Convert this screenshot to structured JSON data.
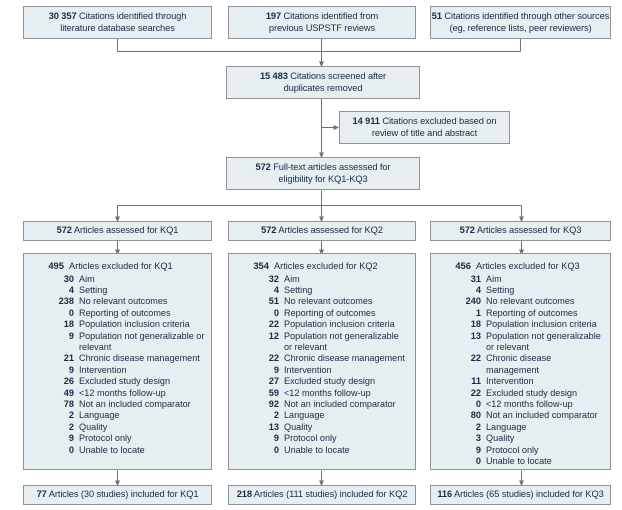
{
  "colors": {
    "box_fill": "#e6eef2",
    "box_border": "#8f9296",
    "text": "#1b2a46",
    "connector": "#6e7278"
  },
  "top_row": [
    {
      "number": "30 357",
      "line1": "Citations identified through",
      "line2": "literature database searches"
    },
    {
      "number": "197",
      "line1": "Citations identified from",
      "line2": "previous USPSTF reviews"
    },
    {
      "number": "51",
      "line1": "Citations identified through other sources",
      "line2": "(eg, reference lists, peer reviewers)"
    }
  ],
  "screened": {
    "number": "15 483",
    "line1": "Citations screened after",
    "line2": "duplicates removed"
  },
  "excluded_title_abstract": {
    "number": "14 911",
    "line1": "Citations excluded based on",
    "line2": "review of title and abstract"
  },
  "fulltext": {
    "number": "572",
    "line1": "Full-text articles assessed for",
    "line2": "eligibility for KQ1-KQ3"
  },
  "assessed": [
    {
      "number": "572",
      "label": "Articles assessed for KQ1"
    },
    {
      "number": "572",
      "label": "Articles assessed for KQ2"
    },
    {
      "number": "572",
      "label": "Articles assessed for KQ3"
    }
  ],
  "exclusions": [
    {
      "head_number": "495",
      "head_label": "Articles excluded for KQ1",
      "reasons": [
        {
          "n": "30",
          "label": "Aim"
        },
        {
          "n": "4",
          "label": "Setting"
        },
        {
          "n": "238",
          "label": "No relevant outcomes"
        },
        {
          "n": "0",
          "label": "Reporting of outcomes"
        },
        {
          "n": "18",
          "label": "Population inclusion criteria"
        },
        {
          "n": "9",
          "label": "Population not generalizable or relevant"
        },
        {
          "n": "21",
          "label": "Chronic disease management"
        },
        {
          "n": "9",
          "label": "Intervention"
        },
        {
          "n": "26",
          "label": "Excluded study design"
        },
        {
          "n": "49",
          "label": "<12 months follow-up"
        },
        {
          "n": "78",
          "label": "Not an included comparator"
        },
        {
          "n": "2",
          "label": "Language"
        },
        {
          "n": "2",
          "label": "Quality"
        },
        {
          "n": "9",
          "label": "Protocol only"
        },
        {
          "n": "0",
          "label": "Unable to locate"
        }
      ]
    },
    {
      "head_number": "354",
      "head_label": "Articles excluded for KQ2",
      "reasons": [
        {
          "n": "32",
          "label": "Aim"
        },
        {
          "n": "4",
          "label": "Setting"
        },
        {
          "n": "51",
          "label": "No relevant outcomes"
        },
        {
          "n": "0",
          "label": "Reporting of outcomes"
        },
        {
          "n": "22",
          "label": "Population inclusion criteria"
        },
        {
          "n": "12",
          "label": "Population not generalizable or relevant"
        },
        {
          "n": "22",
          "label": "Chronic disease management"
        },
        {
          "n": "9",
          "label": "Intervention"
        },
        {
          "n": "27",
          "label": "Excluded study design"
        },
        {
          "n": "59",
          "label": "<12 months follow-up"
        },
        {
          "n": "92",
          "label": "Not an included comparator"
        },
        {
          "n": "2",
          "label": "Language"
        },
        {
          "n": "13",
          "label": "Quality"
        },
        {
          "n": "9",
          "label": "Protocol only"
        },
        {
          "n": "0",
          "label": "Unable to locate"
        }
      ]
    },
    {
      "head_number": "456",
      "head_label": "Articles excluded for KQ3",
      "reasons": [
        {
          "n": "31",
          "label": "Aim"
        },
        {
          "n": "4",
          "label": "Setting"
        },
        {
          "n": "240",
          "label": "No relevant outcomes"
        },
        {
          "n": "1",
          "label": "Reporting of outcomes"
        },
        {
          "n": "18",
          "label": "Population inclusion criteria"
        },
        {
          "n": "13",
          "label": "Population not generalizable or relevant"
        },
        {
          "n": "22",
          "label": "Chronic disease management"
        },
        {
          "n": "11",
          "label": "Intervention"
        },
        {
          "n": "22",
          "label": "Excluded study design"
        },
        {
          "n": "0",
          "label": "<12 months follow-up"
        },
        {
          "n": "80",
          "label": "Not an included comparator"
        },
        {
          "n": "2",
          "label": "Language"
        },
        {
          "n": "3",
          "label": "Quality"
        },
        {
          "n": "9",
          "label": "Protocol only"
        },
        {
          "n": "0",
          "label": "Unable to locate"
        }
      ]
    }
  ],
  "included": [
    {
      "number": "77",
      "label": "Articles (30 studies) included for KQ1"
    },
    {
      "number": "218",
      "label": "Articles (111 studies) included for KQ2"
    },
    {
      "number": "116",
      "label": "Articles (65 studies) included for KQ3"
    }
  ]
}
